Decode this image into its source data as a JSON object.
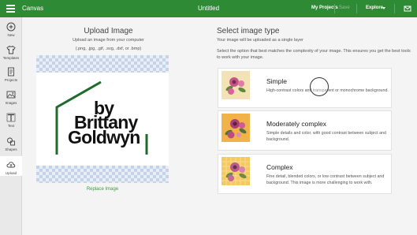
{
  "topbar": {
    "app_name": "Canvas",
    "doc_title": "Untitled",
    "my_projects": "My Projects",
    "save": "Save",
    "explore": "Explore"
  },
  "sidebar": {
    "items": [
      {
        "label": "New",
        "icon": "plus-circle-icon"
      },
      {
        "label": "Templates",
        "icon": "shirt-icon"
      },
      {
        "label": "Projects",
        "icon": "projects-icon"
      },
      {
        "label": "Images",
        "icon": "image-icon"
      },
      {
        "label": "Text",
        "icon": "text-icon"
      },
      {
        "label": "Shapes",
        "icon": "shapes-icon"
      },
      {
        "label": "Upload",
        "icon": "upload-cloud-icon"
      }
    ],
    "active": "Upload"
  },
  "upload": {
    "title": "Upload Image",
    "subtitle": "Upload an image from your computer",
    "formats": "(.png, .jpg, .gif, .svg, .dxf, or .bmp)",
    "logo_lines": [
      "by",
      "Brittany",
      "Goldwyn"
    ],
    "replace_label": "Replace Image"
  },
  "select_type": {
    "title": "Select image type",
    "subtitle": "Your image will be uploaded as a single layer",
    "description": "Select the option that best matches the complexity of your image. This ensures you get the best tools to work with your image.",
    "options": [
      {
        "title": "Simple",
        "description": "High-contrast colors and transparent or monochrome background."
      },
      {
        "title": "Moderately complex",
        "description": "Simple details and color, with good contrast between subject and background."
      },
      {
        "title": "Complex",
        "description": "Fine detail, blended colors, or low contrast between subject and background. This image is more challenging to work with."
      }
    ]
  },
  "colors": {
    "brand_green": "#2f8a36",
    "logo_green": "#1e6b2c",
    "thumb_simple_bg": "#f2e2b6",
    "thumb_moderate_bg": "#f1b24a",
    "thumb_complex_bg": "#f4c95e"
  }
}
